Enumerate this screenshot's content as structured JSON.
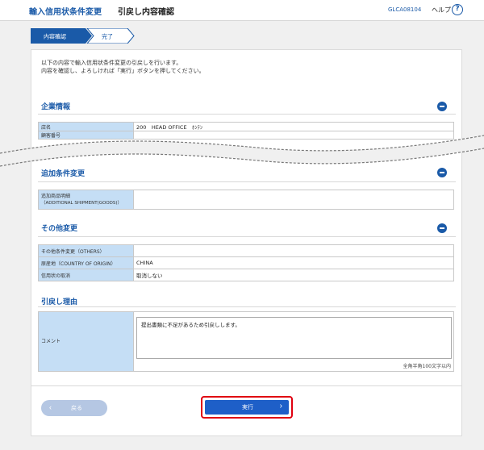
{
  "header": {
    "app_title": "輸入信用状条件変更",
    "page_title": "引戻し内容確認",
    "screen_id": "GLCA08104",
    "help_label": "ヘルプ",
    "help_icon": "question-icon"
  },
  "steps": [
    {
      "label": "内容確認",
      "active": true
    },
    {
      "label": "完了",
      "active": false
    }
  ],
  "intro": {
    "line1": "以下の内容で輸入信用状条件変更の引戻しを行います。",
    "line2": "内容を確認し、よろしければ「実行」ボタンを押してください。"
  },
  "company_section": {
    "title": "企業情報",
    "rows": [
      {
        "label": "店名",
        "value": "200　HEAD OFFICE　ﾎﾝﾃﾝ"
      },
      {
        "label": "顧客番号",
        "value": ""
      }
    ]
  },
  "additional_section": {
    "title": "追加条件変更",
    "rows": [
      {
        "label": "追加商品明細",
        "label2": "（ADDITIONAL SHIPMENT(GOODS)）",
        "value": ""
      }
    ]
  },
  "other_section": {
    "title": "その他変更",
    "rows": [
      {
        "label": "その他条件変更（OTHERS）",
        "value": ""
      },
      {
        "label": "原産地（COUNTRY OF ORIGIN）",
        "value": "CHINA"
      },
      {
        "label": "信用状の取消",
        "value": "取消しない"
      }
    ]
  },
  "reason_section": {
    "title": "引戻し理由",
    "comment_label": "コメント",
    "comment_value": "提出書類に不足があるため引戻しします。",
    "comment_note": "全角半角100文字以内"
  },
  "buttons": {
    "back_label": "戻る",
    "execute_label": "実行"
  },
  "colors": {
    "accent": "#1a5aa8",
    "table_header": "#c5def5",
    "execute_button": "#1e5fc8",
    "highlight": "#e00010"
  }
}
